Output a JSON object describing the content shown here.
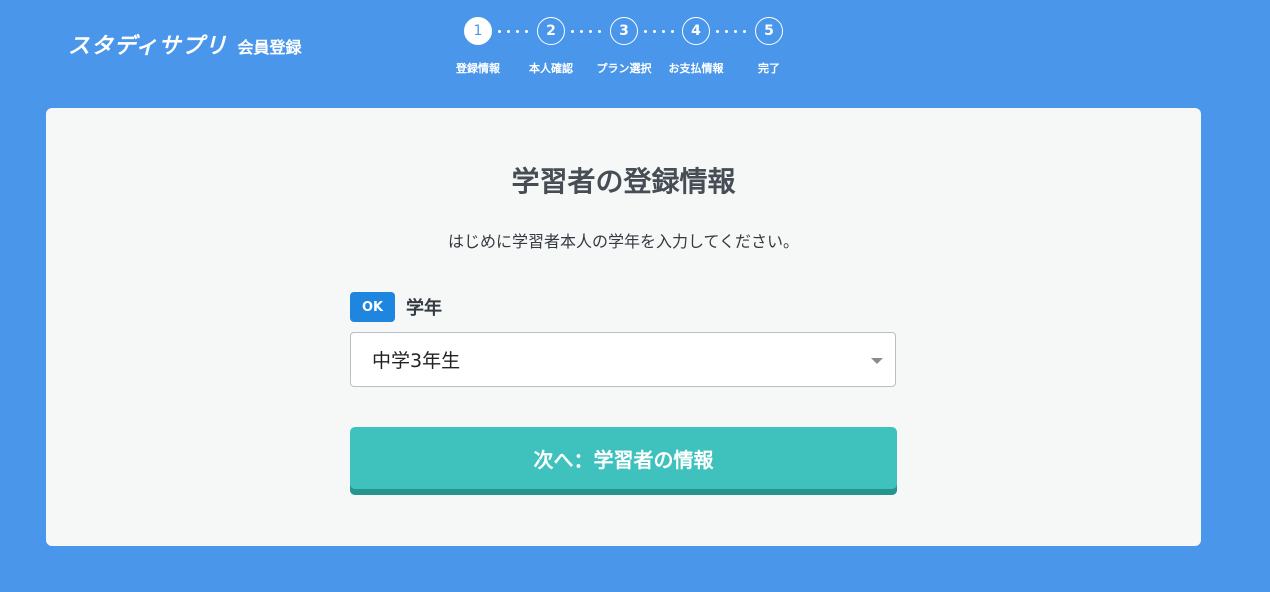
{
  "header": {
    "brand": "スタディサプリ",
    "subtitle": "会員登録"
  },
  "steps": [
    {
      "number": "1",
      "label": "登録情報",
      "active": true
    },
    {
      "number": "2",
      "label": "本人確認",
      "active": false
    },
    {
      "number": "3",
      "label": "プラン選択",
      "active": false
    },
    {
      "number": "4",
      "label": "お支払情報",
      "active": false
    },
    {
      "number": "5",
      "label": "完了",
      "active": false
    }
  ],
  "card": {
    "title": "学習者の登録情報",
    "description": "はじめに学習者本人の学年を入力してください。",
    "field": {
      "badge": "OK",
      "label": "学年",
      "selected_value": "中学3年生"
    },
    "next_button": "次へ：学習者の情報"
  },
  "colors": {
    "background": "#4a96ea",
    "badge": "#1f86e0",
    "button": "#3fc2bd",
    "button_shadow": "#26958f"
  }
}
